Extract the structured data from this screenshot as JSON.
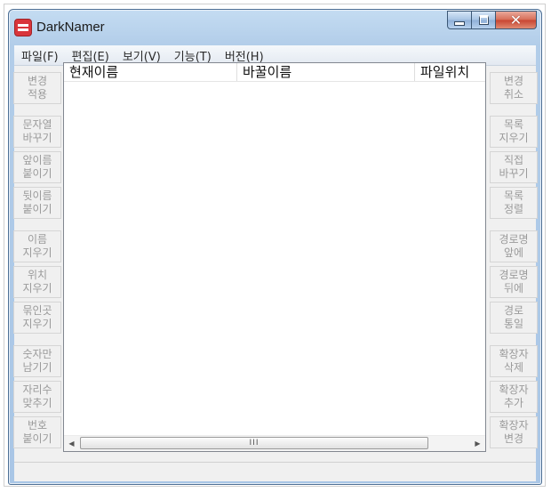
{
  "window": {
    "title": "DarkNamer"
  },
  "menu": [
    "파일(F)",
    "편집(E)",
    "보기(V)",
    "기능(T)",
    "버전(H)"
  ],
  "left_buttons": [
    {
      "l1": "변경",
      "l2": "적용"
    },
    {
      "l1": "문자열",
      "l2": "바꾸기"
    },
    {
      "l1": "앞이름",
      "l2": "붙이기"
    },
    {
      "l1": "뒷이름",
      "l2": "붙이기"
    },
    {
      "l1": "이름",
      "l2": "지우기"
    },
    {
      "l1": "위치",
      "l2": "지우기"
    },
    {
      "l1": "묶인곳",
      "l2": "지우기"
    },
    {
      "l1": "숫자만",
      "l2": "남기기"
    },
    {
      "l1": "자리수",
      "l2": "맞추기"
    },
    {
      "l1": "번호",
      "l2": "붙이기"
    }
  ],
  "right_buttons": [
    {
      "l1": "변경",
      "l2": "취소"
    },
    {
      "l1": "목록",
      "l2": "지우기"
    },
    {
      "l1": "직접",
      "l2": "바꾸기"
    },
    {
      "l1": "목록",
      "l2": "정렬"
    },
    {
      "l1": "경로명",
      "l2": "앞에"
    },
    {
      "l1": "경로명",
      "l2": "뒤에"
    },
    {
      "l1": "경로",
      "l2": "통일"
    },
    {
      "l1": "확장자",
      "l2": "삭제"
    },
    {
      "l1": "확장자",
      "l2": "추가"
    },
    {
      "l1": "확장자",
      "l2": "변경"
    }
  ],
  "list": {
    "columns": [
      "현재이름",
      "바꿀이름",
      "파일위치"
    ]
  },
  "scrollbar": {
    "grip": "III",
    "left_arrow": "◀",
    "right_arrow": "▶"
  },
  "colors": {
    "accent": "#d9353b",
    "title_frame": "#b2cde9",
    "close": "#c84430"
  }
}
